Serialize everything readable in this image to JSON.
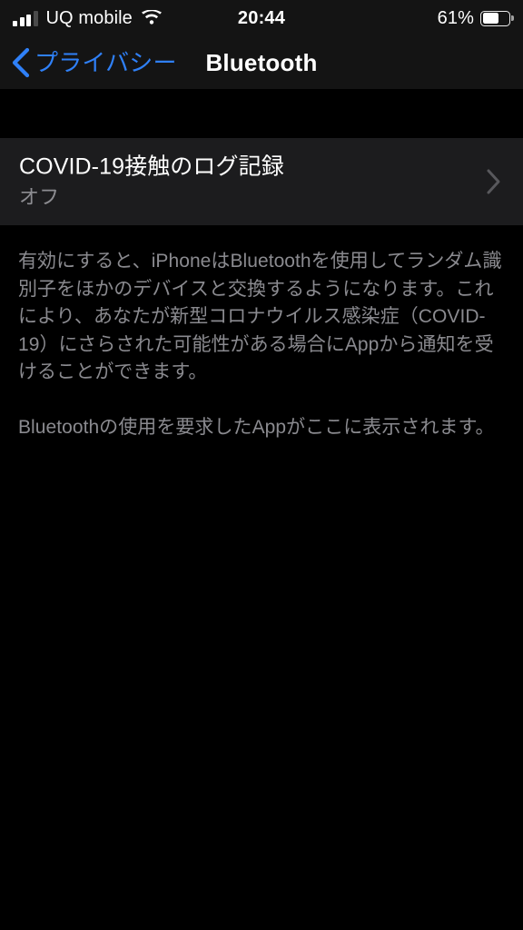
{
  "status_bar": {
    "carrier": "UQ mobile",
    "signal_icon": "cellular-signal-icon",
    "signal_bars_total": 4,
    "signal_bars_filled": 3,
    "wifi_icon": "wifi-icon",
    "time": "20:44",
    "battery_percent_label": "61%",
    "battery_level": 61,
    "battery_icon": "battery-icon"
  },
  "nav_bar": {
    "back_icon": "chevron-left-icon",
    "back_label": "プライバシー",
    "title": "Bluetooth",
    "accent_color": "#2f80f7"
  },
  "settings_cell": {
    "title": "COVID-19接触のログ記録",
    "subtitle": "オフ",
    "disclosure_icon": "chevron-right-icon"
  },
  "footer": {
    "paragraph_1": "有効にすると、iPhoneはBluetoothを使用してランダム識別子をほかのデバイスと交換するようになります。これにより、あなたが新型コロナウイルス感染症（COVID-19）にさらされた可能性がある場合にAppから通知を受けることができます。",
    "paragraph_2": "Bluetoothの使用を要求したAppがここに表示されます。"
  },
  "colors": {
    "background": "#000000",
    "bar_background": "#141414",
    "cell_background": "#1c1c1e",
    "primary_text": "#ffffff",
    "secondary_text": "#8a8a8f",
    "accent": "#2f80f7"
  }
}
